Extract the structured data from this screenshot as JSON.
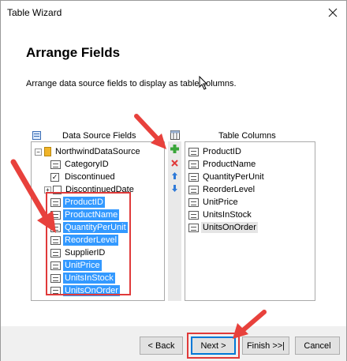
{
  "window": {
    "title": "Table Wizard"
  },
  "page": {
    "heading": "Arrange Fields",
    "description": "Arrange data source fields to display as table columns."
  },
  "left_panel": {
    "label": "Data Source Fields",
    "root": "NorthwindDataSource",
    "items": [
      {
        "label": "CategoryID",
        "selected": false,
        "icon": "numeric-field-icon"
      },
      {
        "label": "Discontinued",
        "selected": false,
        "icon": "checkbox-field-icon"
      },
      {
        "label": "DiscontinuedDate",
        "selected": false,
        "icon": "date-field-icon",
        "expandable": true
      },
      {
        "label": "ProductID",
        "selected": true,
        "icon": "numeric-field-icon"
      },
      {
        "label": "ProductName",
        "selected": true,
        "icon": "text-field-icon"
      },
      {
        "label": "QuantityPerUnit",
        "selected": true,
        "icon": "text-field-icon"
      },
      {
        "label": "ReorderLevel",
        "selected": true,
        "icon": "numeric-field-icon"
      },
      {
        "label": "SupplierID",
        "selected": false,
        "icon": "numeric-field-icon"
      },
      {
        "label": "UnitPrice",
        "selected": true,
        "icon": "decimal-field-icon"
      },
      {
        "label": "UnitsInStock",
        "selected": true,
        "icon": "numeric-field-icon"
      },
      {
        "label": "UnitsOnOrder",
        "selected": true,
        "icon": "numeric-field-icon"
      }
    ]
  },
  "right_panel": {
    "label": "Table Columns",
    "items": [
      {
        "label": "ProductID",
        "icon": "numeric-field-icon"
      },
      {
        "label": "ProductName",
        "icon": "text-field-icon"
      },
      {
        "label": "QuantityPerUnit",
        "icon": "text-field-icon"
      },
      {
        "label": "ReorderLevel",
        "icon": "numeric-field-icon"
      },
      {
        "label": "UnitPrice",
        "icon": "decimal-field-icon"
      },
      {
        "label": "UnitsInStock",
        "icon": "numeric-field-icon"
      },
      {
        "label": "UnitsOnOrder",
        "icon": "numeric-field-icon"
      }
    ]
  },
  "buttons": {
    "back": "< Back",
    "next": "Next >",
    "finish": "Finish >>|",
    "cancel": "Cancel"
  },
  "colors": {
    "selection": "#3399ff",
    "annotation_arrow": "#e8413c",
    "add_icon": "#3aa63a",
    "remove_icon": "#e03a3a",
    "move_icon": "#2f7ad8"
  }
}
